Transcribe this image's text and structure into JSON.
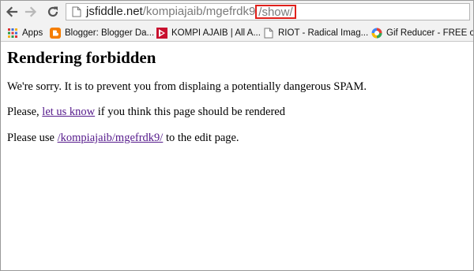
{
  "browser": {
    "url_host": "jsfiddle.net",
    "url_path": "/kompiajaib/mgefrdk9",
    "url_highlight": "/show/",
    "highlight_color": "#e0201b"
  },
  "bookmarks": [
    {
      "label": "Apps",
      "icon": "apps-grid-icon"
    },
    {
      "label": "Blogger: Blogger Da...",
      "icon": "blogger-icon"
    },
    {
      "label": "KOMPI AJAIB | All A...",
      "icon": "kompi-ajaib-icon"
    },
    {
      "label": "RIOT - Radical Imag...",
      "icon": "page-icon"
    },
    {
      "label": "Gif Reducer - FREE o...",
      "icon": "gif-reducer-icon"
    }
  ],
  "page": {
    "heading": "Rendering forbidden",
    "line1": "We're sorry. It is to prevent you from displaing a potentially dangerous SPAM.",
    "line2_before": "Please, ",
    "line2_link": "let us know",
    "line2_after": " if you think this page should be rendered",
    "line3_before": "Please use ",
    "line3_link": "/kompiajaib/mgefrdk9/",
    "line3_after": " to the edit page.",
    "link_color": "#551a8b"
  }
}
